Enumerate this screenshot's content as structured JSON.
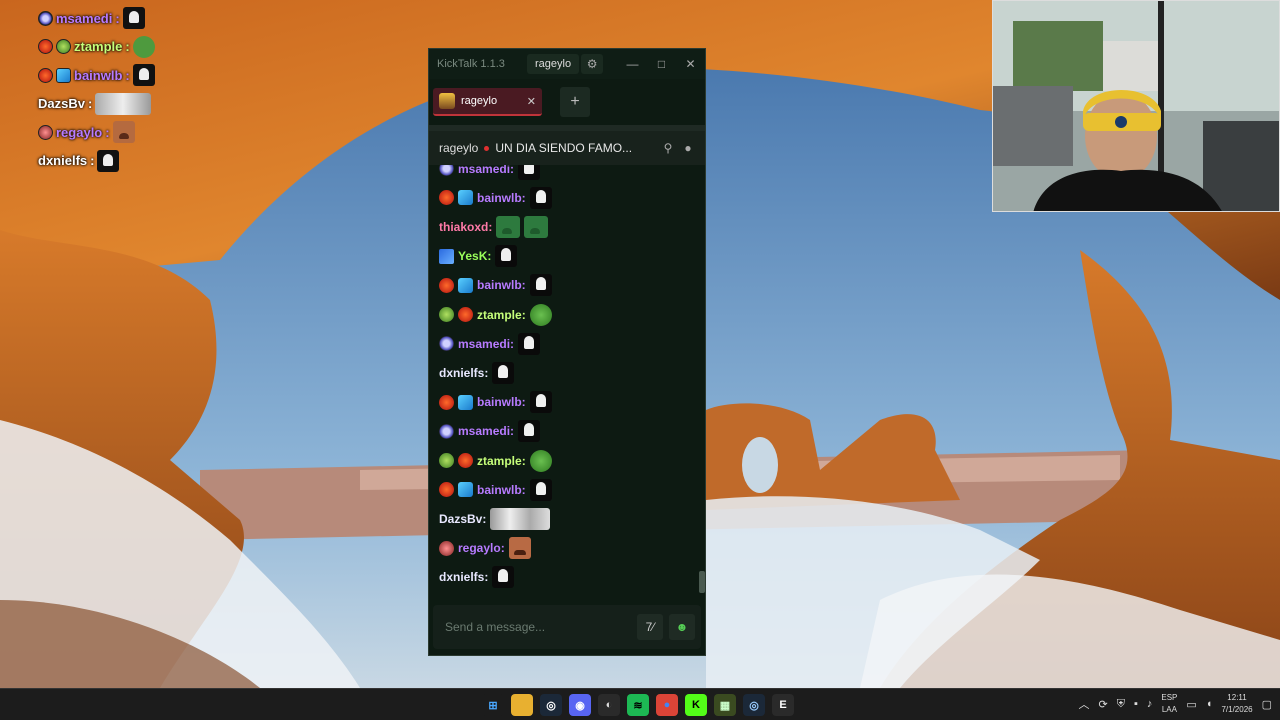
{
  "overlay_chat": [
    {
      "user": "msamedi",
      "color": "#b77bff",
      "badges": [
        "b-sub"
      ],
      "emote": "ghost"
    },
    {
      "user": "ztample",
      "color": "#c6ff7a",
      "badges": [
        "b-red",
        "b-alien"
      ],
      "emote": "pepe"
    },
    {
      "user": "bainwlb",
      "color": "#b77bff",
      "badges": [
        "b-red",
        "b-cube"
      ],
      "emote": "ghost"
    },
    {
      "user": "DazsBv",
      "color": "#ffffff",
      "badges": [],
      "emote": "wide"
    },
    {
      "user": "regaylo",
      "color": "#b77bff",
      "badges": [
        "b-face"
      ],
      "emote": "face"
    },
    {
      "user": "dxnielfs",
      "color": "#ffffff",
      "badges": [],
      "emote": "ghost"
    }
  ],
  "window": {
    "app_title": "KickTalk 1.1.3",
    "user_chip": "rageylo",
    "minimize": "—",
    "maximize": "□",
    "close": "✕"
  },
  "tabs": [
    {
      "label": "rageylo",
      "close": "✕"
    }
  ],
  "add_tab": "+",
  "channel": {
    "name": "rageylo",
    "title": "UN DIA SIENDO FAMO..."
  },
  "messages": [
    {
      "user": "msamedi",
      "suffix": ":",
      "color": "#b77bff",
      "badges": [
        "b-sub"
      ],
      "emotes": [
        "ghost"
      ]
    },
    {
      "user": "bainwlb",
      "suffix": ":",
      "color": "#b77bff",
      "badges": [
        "b-red",
        "b-cube"
      ],
      "emotes": [
        "ghost"
      ]
    },
    {
      "user": "thiakoxd",
      "suffix": ":",
      "color": "#ff7aa8",
      "badges": [],
      "emotes": [
        "green",
        "green"
      ]
    },
    {
      "user": "YesK",
      "suffix": ":",
      "color": "#9aff5a",
      "badges": [
        "b-blue"
      ],
      "emotes": [
        "ghost"
      ]
    },
    {
      "user": "bainwlb",
      "suffix": ":",
      "color": "#b77bff",
      "badges": [
        "b-red",
        "b-cube"
      ],
      "emotes": [
        "ghost"
      ]
    },
    {
      "user": "ztample",
      "suffix": ":",
      "color": "#c6ff7a",
      "badges": [
        "b-alien",
        "b-red"
      ],
      "emotes": [
        "pepe"
      ]
    },
    {
      "user": "msamedi",
      "suffix": ":",
      "color": "#b77bff",
      "badges": [
        "b-sub"
      ],
      "emotes": [
        "ghost"
      ]
    },
    {
      "user": "dxnielfs",
      "suffix": ":",
      "color": "#e8e8ff",
      "badges": [],
      "emotes": [
        "ghost"
      ]
    },
    {
      "user": "bainwlb",
      "suffix": ":",
      "color": "#b77bff",
      "badges": [
        "b-red",
        "b-cube"
      ],
      "emotes": [
        "ghost"
      ]
    },
    {
      "user": "msamedi",
      "suffix": ":",
      "color": "#b77bff",
      "badges": [
        "b-sub"
      ],
      "emotes": [
        "ghost"
      ]
    },
    {
      "user": "ztample",
      "suffix": ":",
      "color": "#c6ff7a",
      "badges": [
        "b-alien",
        "b-red"
      ],
      "emotes": [
        "pepe"
      ]
    },
    {
      "user": "bainwlb",
      "suffix": ":",
      "color": "#b77bff",
      "badges": [
        "b-red",
        "b-cube"
      ],
      "emotes": [
        "ghost"
      ]
    },
    {
      "user": "DazsBv",
      "suffix": ":",
      "color": "#e8e8ff",
      "badges": [],
      "emotes": [
        "wide"
      ]
    },
    {
      "user": "regaylo",
      "suffix": ":",
      "color": "#b77bff",
      "badges": [
        "b-face"
      ],
      "emotes": [
        "face"
      ]
    },
    {
      "user": "dxnielfs",
      "suffix": ":",
      "color": "#e8e8ff",
      "badges": [],
      "emotes": [
        "ghost"
      ]
    }
  ],
  "input": {
    "placeholder": "Send a message...",
    "value": ""
  },
  "taskbar": {
    "apps": [
      {
        "name": "windows-start-icon",
        "bg": "#1c1c1c",
        "glyph": "⊞",
        "color": "#4aa8ff"
      },
      {
        "name": "file-explorer-icon",
        "bg": "#e8b030",
        "glyph": "",
        "color": "#fff"
      },
      {
        "name": "steam-icon",
        "bg": "#1b2838",
        "glyph": "◎",
        "color": "#fff"
      },
      {
        "name": "discord-icon",
        "bg": "#5865f2",
        "glyph": "◉",
        "color": "#fff"
      },
      {
        "name": "obs-icon",
        "bg": "#2a2a2a",
        "glyph": "◐",
        "color": "#ddd"
      },
      {
        "name": "spotify-icon",
        "bg": "#1db954",
        "glyph": "≋",
        "color": "#000"
      },
      {
        "name": "chrome-icon",
        "bg": "#db4437",
        "glyph": "●",
        "color": "#4285f4"
      },
      {
        "name": "kick-icon",
        "bg": "#53fc18",
        "glyph": "K",
        "color": "#000"
      },
      {
        "name": "kicktalk-icon",
        "bg": "#3a4a20",
        "glyph": "▦",
        "color": "#cfc"
      },
      {
        "name": "steam-app-icon",
        "bg": "#1b2838",
        "glyph": "◎",
        "color": "#9cf"
      },
      {
        "name": "epic-games-icon",
        "bg": "#2a2a2a",
        "glyph": "E",
        "color": "#fff"
      }
    ],
    "lang_top": "ESP",
    "lang_bottom": "LAA",
    "time": "12:11",
    "date": "7/1/2026"
  }
}
